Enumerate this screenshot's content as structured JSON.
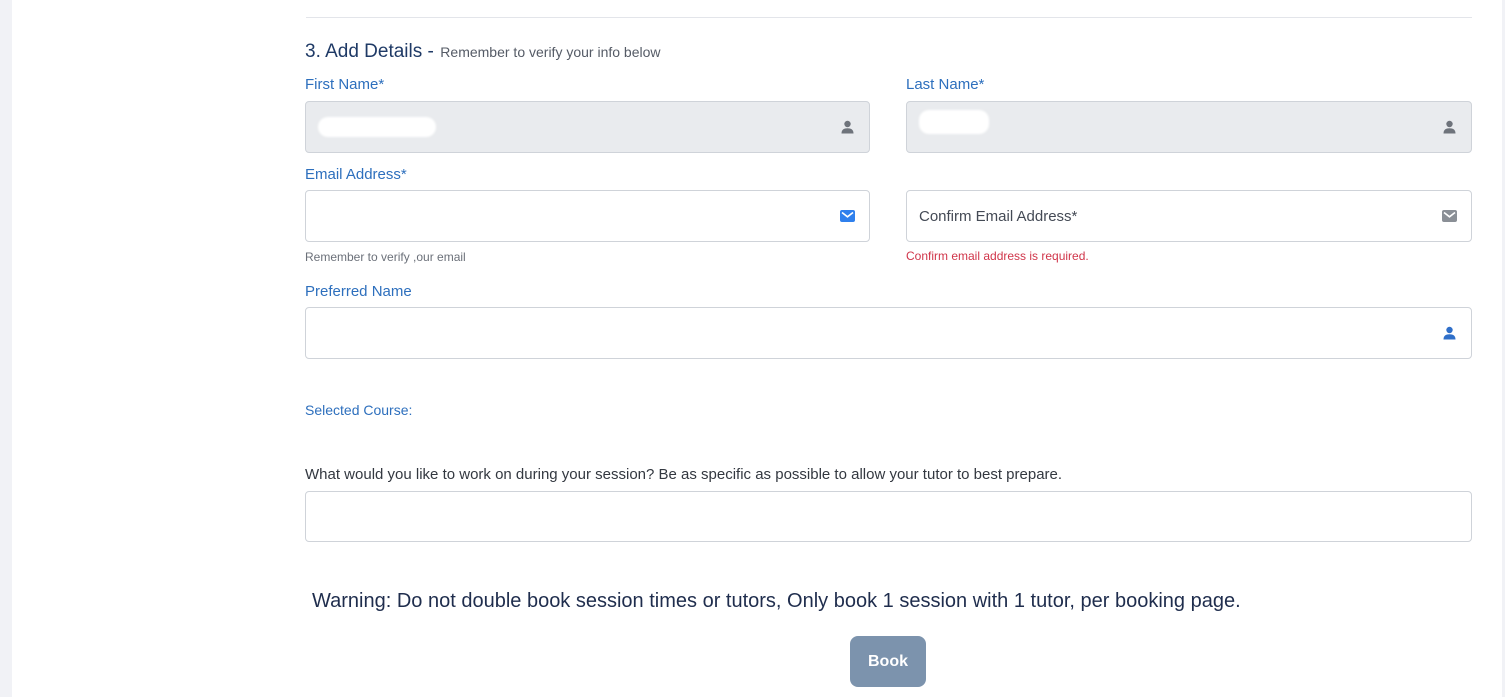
{
  "form": {
    "section_title": "3. Add Details -",
    "section_subtitle": "Remember to verify your info below",
    "first_name": {
      "label": "First Name*",
      "value": ""
    },
    "last_name": {
      "label": "Last Name*",
      "value": ""
    },
    "email": {
      "label": "Email Address*",
      "value": "",
      "help": "Remember to verify ,our email"
    },
    "confirm_email": {
      "placeholder": "Confirm Email Address*",
      "value": "",
      "error": "Confirm email address is required."
    },
    "preferred_name": {
      "label": "Preferred Name",
      "value": ""
    },
    "selected_course_label": "Selected Course:",
    "session_question": "What would you like to work on during your session? Be as specific as possible to allow your tutor to best prepare.",
    "session_details_value": "",
    "warning": "Warning: Do not double book session times or tutors, Only book 1 session with 1 tutor, per booking page.",
    "book_label": "Book"
  },
  "icons": {
    "first_name": "user-icon",
    "last_name": "user-icon",
    "email": "envelope-icon",
    "confirm_email": "envelope-icon",
    "preferred_name": "user-icon"
  },
  "colors": {
    "label_blue": "#2d6fbd",
    "error_red": "#d0354a",
    "button": "#7c93ad",
    "email_icon_active": "#2f80ed",
    "icon_gray": "#7a7f87"
  }
}
